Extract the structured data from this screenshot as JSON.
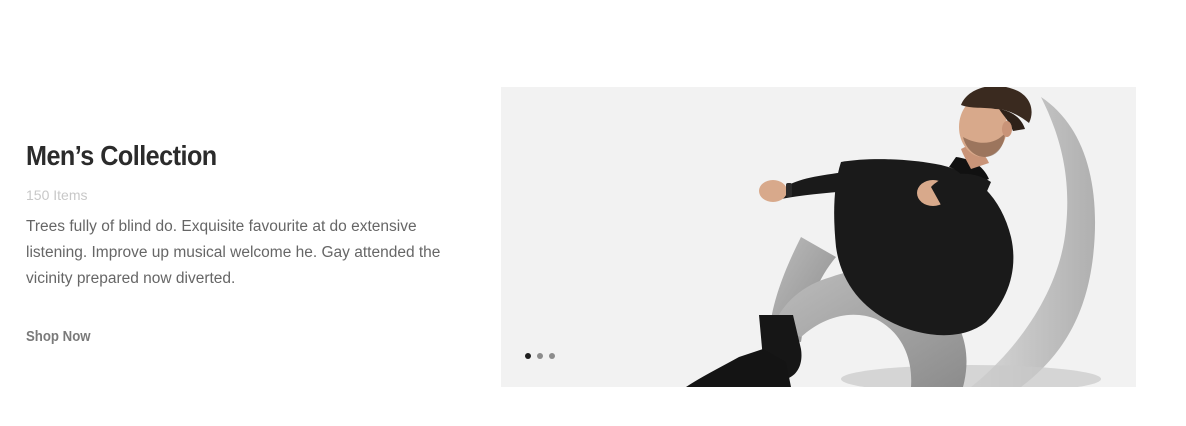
{
  "promo": {
    "title": "Men’s Collection",
    "item_count": "150 Items",
    "description": "Trees fully of blind do. Exquisite favourite at do extensive listening. Improve up musical welcome he. Gay attended the vicinity prepared now diverted.",
    "cta_label": "Shop Now"
  },
  "slider": {
    "image": "man-seated-black-turtleneck-grey-jeans",
    "background_color": "#f2f2f2",
    "dots": [
      {
        "active": true
      },
      {
        "active": false
      },
      {
        "active": false
      }
    ]
  }
}
